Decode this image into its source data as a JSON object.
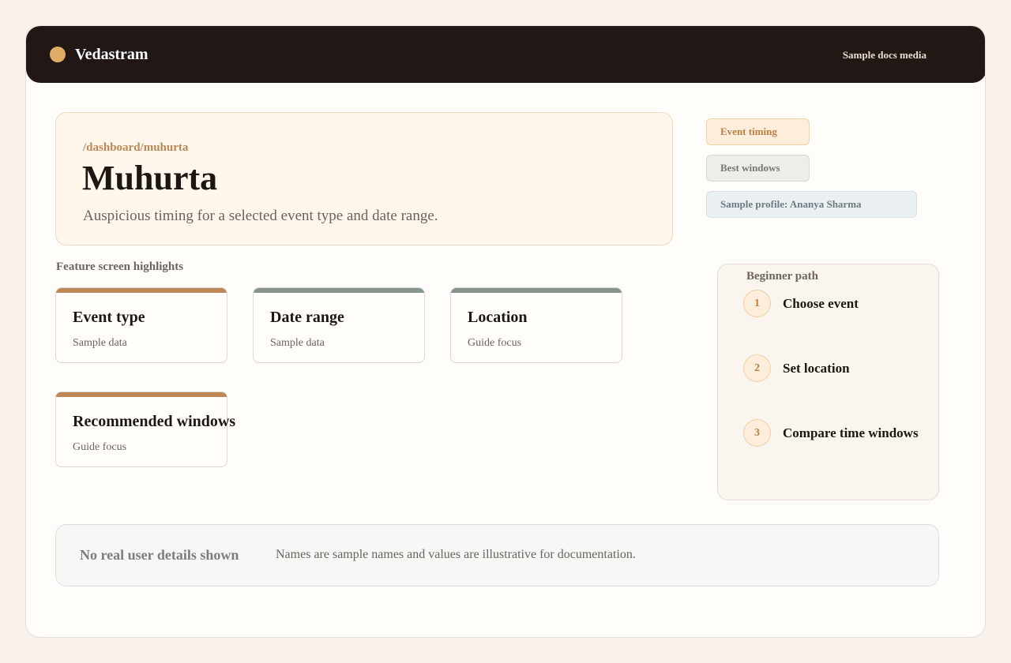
{
  "app": {
    "brand_name": "Vedastram",
    "top_link": "Sample docs media"
  },
  "hero": {
    "path": "/dashboard/muhurta",
    "title": "Muhurta",
    "subtitle": "Auspicious timing for a selected event type and date range."
  },
  "tags": {
    "event_timing": "Event timing",
    "best_windows": "Best windows",
    "sample_profile": "Sample profile: Ananya Sharma"
  },
  "highlights": {
    "label": "Feature screen highlights",
    "cards": [
      {
        "title": "Event type",
        "subtitle": "Sample data"
      },
      {
        "title": "Date range",
        "subtitle": "Sample data"
      },
      {
        "title": "Location",
        "subtitle": "Guide focus"
      },
      {
        "title": "Recommended windows",
        "subtitle": "Guide focus"
      }
    ]
  },
  "beginner_path": {
    "label": "Beginner path",
    "steps": [
      {
        "num": "1",
        "label": "Choose event"
      },
      {
        "num": "2",
        "label": "Set location"
      },
      {
        "num": "3",
        "label": "Compare time windows"
      }
    ]
  },
  "notice": {
    "title": "No real user details shown",
    "text": "Names are sample names and values are illustrative for documentation."
  },
  "colors": {
    "topbar": "#211714",
    "accent": "#bd8756",
    "brand_dot": "#e0ac67",
    "sage": "#869490"
  }
}
